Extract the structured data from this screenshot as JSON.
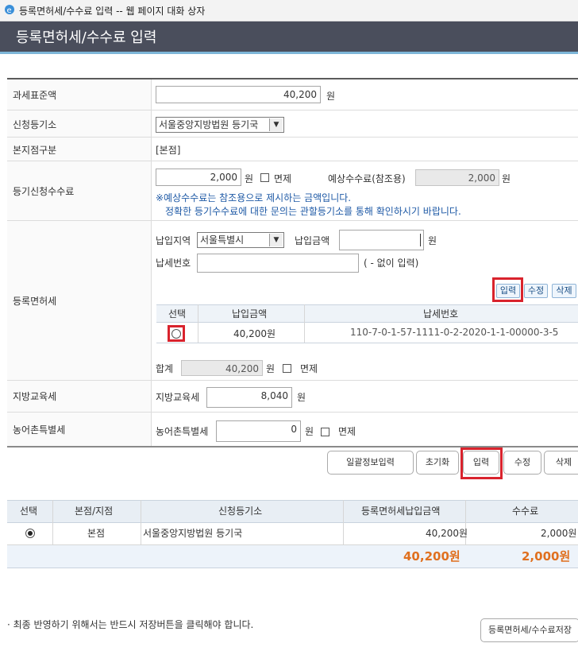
{
  "window": {
    "title": "등록면허세/수수료 입력 -- 웹 페이지 대화 상자"
  },
  "header": {
    "title": "등록면허세/수수료 입력"
  },
  "form": {
    "tax_base": {
      "label": "과세표준액",
      "value": "40,200",
      "unit": "원"
    },
    "registry": {
      "label": "신청등기소",
      "selected": "서울중앙지방법원 등기국"
    },
    "branch": {
      "label": "본지점구분",
      "value": "[본점]"
    },
    "fee": {
      "label": "등기신청수수료",
      "value": "2,000",
      "unit": "원",
      "exempt_label": "면제",
      "expected_label": "예상수수료(참조용)",
      "expected_value": "2,000",
      "expected_unit": "원",
      "notice1": "※예상수수료는 참조용으로 제시하는 금액입니다.",
      "notice2": "정확한 등기수수료에 대한 문의는 관할등기소를 통해 확인하시기 바랍니다."
    },
    "license_tax": {
      "label": "등록면허세",
      "region_label": "납입지역",
      "region_selected": "서울특별시",
      "amount_label": "납입금액",
      "amount_value": "",
      "amount_unit": "원",
      "taxno_label": "납세번호",
      "taxno_value": "",
      "taxno_hint": "( - 없이 입력)",
      "buttons": {
        "input": "입력",
        "edit": "수정",
        "delete": "삭제"
      },
      "table": {
        "headers": [
          "선택",
          "납입금액",
          "납세번호"
        ],
        "rows": [
          {
            "amount": "40,200원",
            "taxno": "110-7-0-1-57-1111-0-2-2020-1-1-00000-3-5"
          }
        ]
      },
      "sum_label": "합계",
      "sum_value": "40,200",
      "sum_unit": "원",
      "sum_exempt_label": "면제"
    },
    "edu_tax": {
      "label": "지방교육세",
      "field_label": "지방교육세",
      "value": "8,040",
      "unit": "원"
    },
    "rural_tax": {
      "label": "농어촌특별세",
      "field_label": "농어촌특별세",
      "value": "0",
      "unit": "원",
      "exempt_label": "면제"
    }
  },
  "actions": {
    "bulk": "일괄정보입력",
    "reset": "초기화",
    "input": "입력",
    "edit": "수정",
    "delete": "삭제"
  },
  "summary": {
    "headers": [
      "선택",
      "본점/지점",
      "신청등기소",
      "등록면허세납입금액",
      "수수료"
    ],
    "rows": [
      {
        "branch": "본점",
        "registry": "서울중앙지방법원 등기국",
        "tax": "40,200원",
        "fee": "2,000원",
        "selected": true
      }
    ],
    "total_tax": "40,200원",
    "total_fee": "2,000원"
  },
  "footer": {
    "notice": "· 최종 반영하기 위해서는 반드시 저장버튼을 클릭해야 합니다.",
    "save": "등록면허세/수수료저장"
  }
}
